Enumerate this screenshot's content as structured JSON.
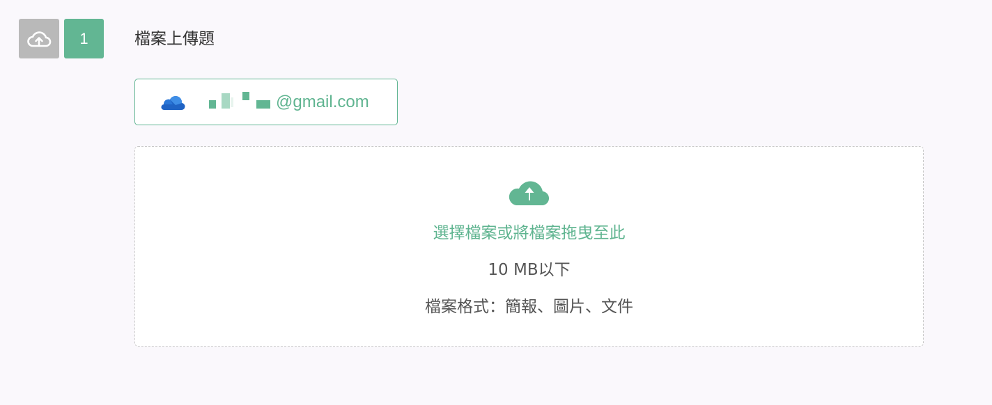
{
  "question": {
    "type_icon": "cloud-upload-icon",
    "number": "1",
    "title": "檔案上傳題"
  },
  "account": {
    "provider_icon": "onedrive-cloud-icon",
    "email_visible_suffix": "@gmail.com",
    "email_prefix_masked": true
  },
  "dropzone": {
    "icon": "cloud-upload-icon",
    "prompt": "選擇檔案或將檔案拖曳至此",
    "size_limit": "10 MB以下",
    "formats": "檔案格式：簡報、圖片、文件"
  },
  "colors": {
    "accent": "#62b693",
    "type_icon_bg": "#b9b9b9",
    "page_bg": "#faf8fc",
    "onedrive_blue": "#1f63c4"
  }
}
